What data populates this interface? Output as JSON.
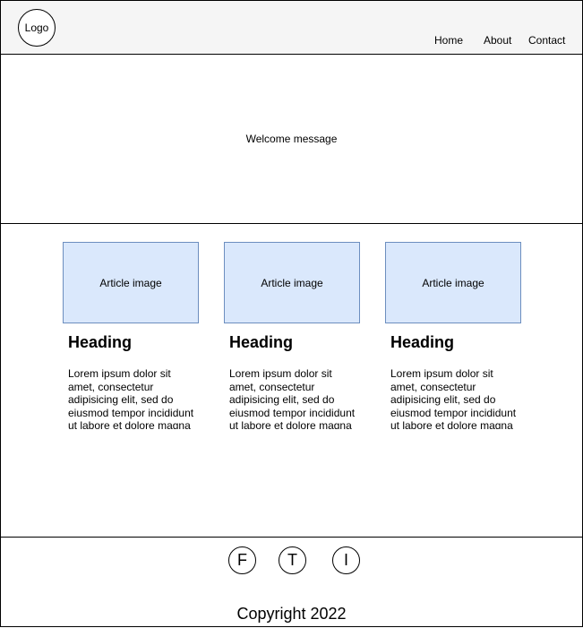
{
  "header": {
    "logo_label": "Logo",
    "nav": [
      {
        "label": "Home"
      },
      {
        "label": "About"
      },
      {
        "label": "Contact"
      }
    ]
  },
  "hero": {
    "message": "Welcome message"
  },
  "articles": [
    {
      "image_label": "Article image",
      "heading": "Heading",
      "body": "Lorem ipsum dolor sit amet, consectetur adipisicing elit, sed do eiusmod tempor incididunt ut labore et dolore magna"
    },
    {
      "image_label": "Article image",
      "heading": "Heading",
      "body": "Lorem ipsum dolor sit amet, consectetur adipisicing elit, sed do eiusmod tempor incididunt ut labore et dolore magna"
    },
    {
      "image_label": "Article image",
      "heading": "Heading",
      "body": "Lorem ipsum dolor sit amet, consectetur adipisicing elit, sed do eiusmod tempor incididunt ut labore et dolore magna"
    }
  ],
  "footer": {
    "social": [
      {
        "label": "F",
        "icon": "facebook-icon"
      },
      {
        "label": "T",
        "icon": "twitter-icon"
      },
      {
        "label": "I",
        "icon": "instagram-icon"
      }
    ],
    "copyright": "Copyright 2022"
  },
  "colors": {
    "header_bg": "#f5f5f5",
    "image_fill": "#dae8fc",
    "image_border": "#6c8ebf",
    "border": "#000000"
  }
}
